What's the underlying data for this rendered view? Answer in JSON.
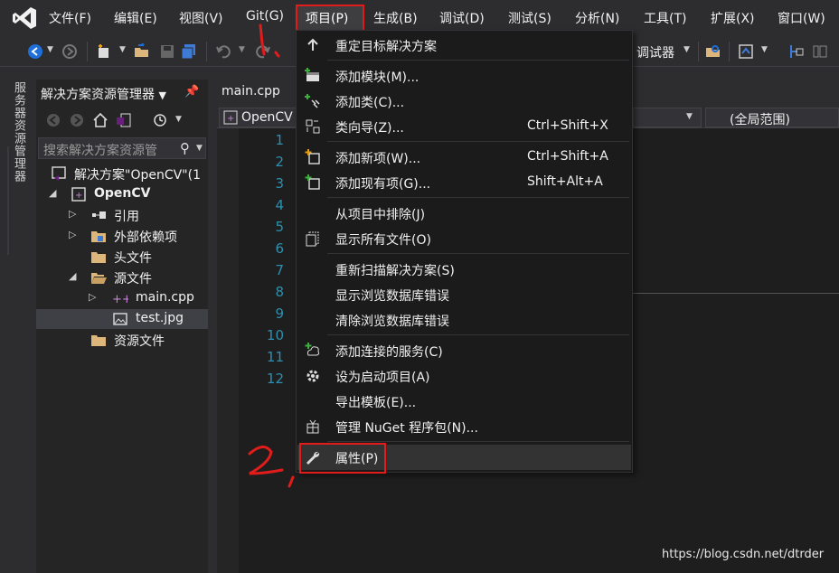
{
  "menu": [
    "文件(F)",
    "编辑(E)",
    "视图(V)",
    "Git(G)",
    "项目(P)",
    "生成(B)",
    "调试(D)",
    "测试(S)",
    "分析(N)",
    "工具(T)",
    "扩展(X)",
    "窗口(W)"
  ],
  "toolbar": {
    "debugger_label": "调试器"
  },
  "side_strip": {
    "label": "服务器资源管理器"
  },
  "solution_explorer": {
    "title": "解决方案资源管理器",
    "search_placeholder": "搜索解决方案资源管",
    "tree": [
      {
        "label": "解决方案\"OpenCV\"(1",
        "bold": false
      },
      {
        "label": "OpenCV",
        "bold": true
      },
      {
        "label": "引用",
        "bold": false
      },
      {
        "label": "外部依赖项",
        "bold": false
      },
      {
        "label": "头文件",
        "bold": false
      },
      {
        "label": "源文件",
        "bold": false
      },
      {
        "label": "main.cpp",
        "bold": false
      },
      {
        "label": "test.jpg",
        "bold": false,
        "selected": true
      },
      {
        "label": "资源文件",
        "bold": false
      }
    ]
  },
  "editor": {
    "tab": "main.cpp",
    "nav_project": "OpenCV",
    "nav_scope": "(全局范围)",
    "line_numbers": [
      "1",
      "2",
      "3",
      "4",
      "5",
      "6",
      "7",
      "8",
      "9",
      "10",
      "11",
      "12"
    ]
  },
  "project_menu": [
    {
      "label": "重定目标解决方案",
      "shortcut": "",
      "icon": "retarget-arrow-icon"
    },
    {
      "label": "添加模块(M)...",
      "shortcut": "",
      "icon": "add-module-icon"
    },
    {
      "label": "添加类(C)...",
      "shortcut": "",
      "icon": "add-class-icon"
    },
    {
      "label": "类向导(Z)...",
      "shortcut": "Ctrl+Shift+X",
      "icon": "class-wizard-icon"
    },
    {
      "label": "添加新项(W)...",
      "shortcut": "Ctrl+Shift+A",
      "icon": "add-new-item-icon"
    },
    {
      "label": "添加现有项(G)...",
      "shortcut": "Shift+Alt+A",
      "icon": "add-existing-item-icon"
    },
    {
      "label": "从项目中排除(J)",
      "shortcut": "",
      "icon": ""
    },
    {
      "label": "显示所有文件(O)",
      "shortcut": "",
      "icon": "show-all-files-icon"
    },
    {
      "label": "重新扫描解决方案(S)",
      "shortcut": "",
      "icon": ""
    },
    {
      "label": "显示浏览数据库错误",
      "shortcut": "",
      "icon": ""
    },
    {
      "label": "清除浏览数据库错误",
      "shortcut": "",
      "icon": ""
    },
    {
      "label": "添加连接的服务(C)",
      "shortcut": "",
      "icon": "connected-service-icon"
    },
    {
      "label": "设为启动项目(A)",
      "shortcut": "",
      "icon": "gear-icon"
    },
    {
      "label": "导出模板(E)...",
      "shortcut": "",
      "icon": ""
    },
    {
      "label": "管理 NuGet 程序包(N)...",
      "shortcut": "",
      "icon": "nuget-icon"
    },
    {
      "label": "属性(P)",
      "shortcut": "",
      "icon": "wrench-icon"
    }
  ],
  "annotations": {
    "step1": "1.",
    "step2": "2."
  },
  "watermark": "https://blog.csdn.net/dtrder",
  "colors": {
    "accent": "#68217a",
    "highlight_box": "#e21b1b",
    "line_number": "#2b91af"
  }
}
